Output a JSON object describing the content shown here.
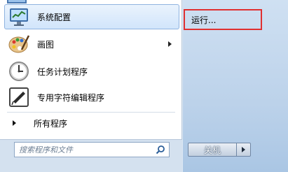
{
  "programs": [
    {
      "label": "系统配置",
      "icon": "system-config-icon",
      "selected": true
    },
    {
      "label": "画图",
      "icon": "paint-icon",
      "has_submenu": true
    },
    {
      "label": "任务计划程序",
      "icon": "task-scheduler-icon"
    },
    {
      "label": "专用字符编辑程序",
      "icon": "private-character-editor-icon"
    }
  ],
  "all_programs_label": "所有程序",
  "search": {
    "placeholder": "搜索程序和文件"
  },
  "right_panel": {
    "run_label": "运行..."
  },
  "shutdown": {
    "label": "关机"
  },
  "colors": {
    "highlight_border": "#e03030",
    "selection": "#d1e5fb",
    "right_panel": "#bcd2ea"
  }
}
